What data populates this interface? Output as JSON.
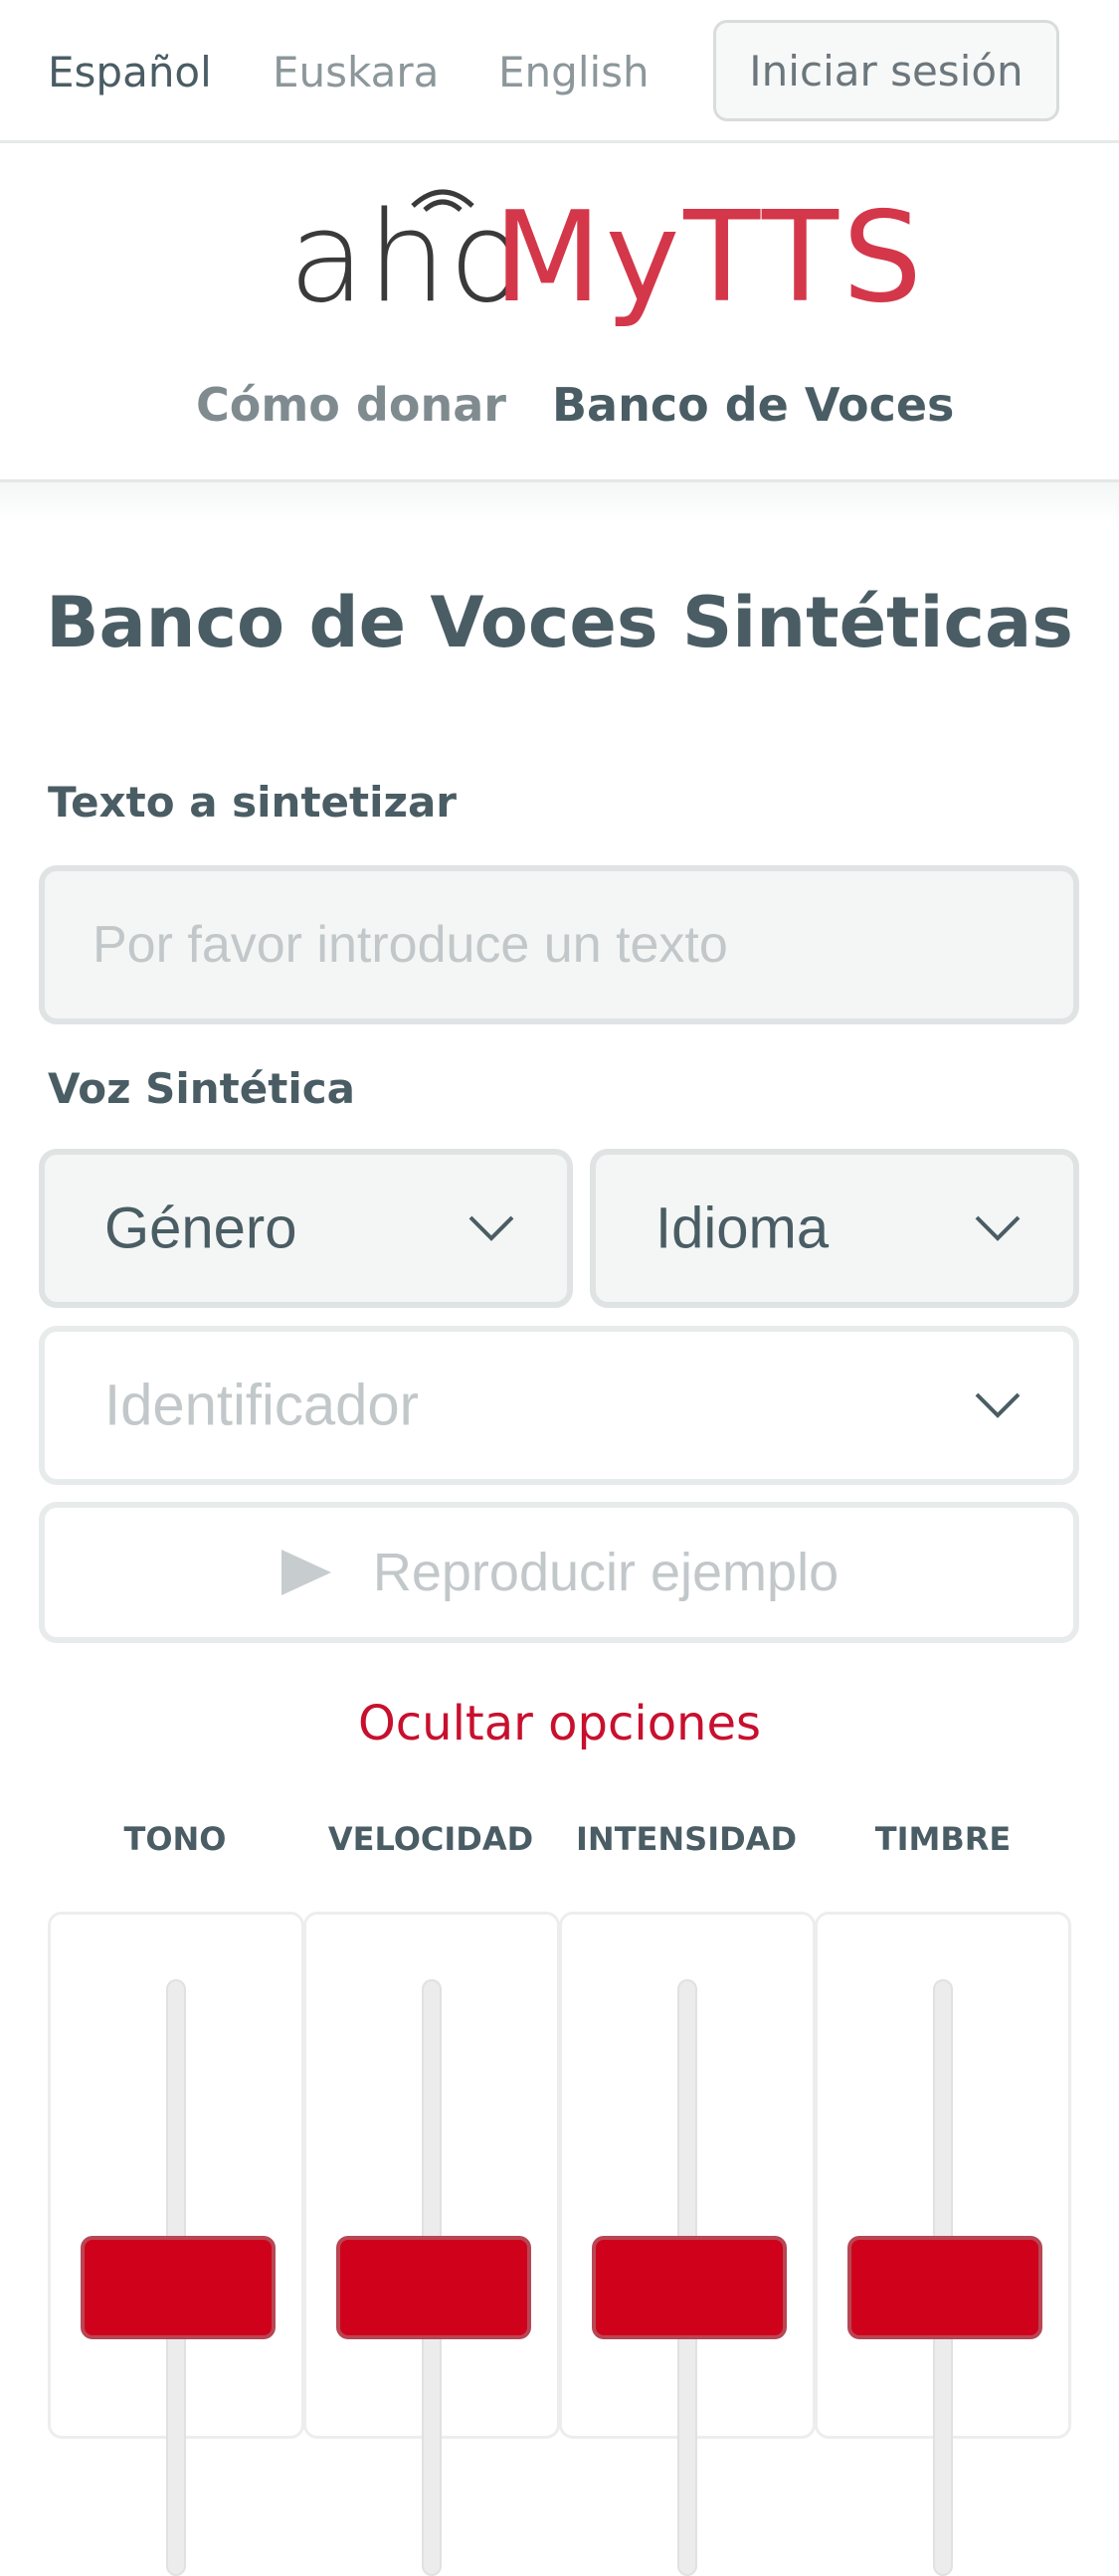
{
  "languages": [
    "Español",
    "Euskara",
    "English"
  ],
  "active_language": "Español",
  "login_label": "Iniciar sesión",
  "logo": {
    "prefix": "aho",
    "brand": "MyTTS",
    "brand_color": "#d4374a"
  },
  "nav": {
    "donate": "Cómo donar",
    "voice_bank": "Banco de Voces"
  },
  "page_title": "Banco de Voces Sintéticas",
  "text_section": {
    "label": "Texto a sintetizar",
    "placeholder": "Por favor introduce un texto",
    "value": ""
  },
  "voice_section": {
    "label": "Voz Sintética",
    "gender_select": "Género",
    "language_select": "Idioma",
    "identifier_placeholder": "Identificador",
    "play_sample": "Reproducir ejemplo"
  },
  "options_toggle": "Ocultar opciones",
  "sliders": [
    {
      "label": "TONO",
      "level": 0.5
    },
    {
      "label": "VELOCIDAD",
      "level": 0.5
    },
    {
      "label": "INTENSIDAD",
      "level": 0.5
    },
    {
      "label": "TIMBRE",
      "level": 0.5
    }
  ],
  "colors": {
    "accent": "#c8102e",
    "slider_thumb": "#d0021b",
    "text": "#4a5d64"
  },
  "icons": {
    "dropdown": "chevron-down-icon",
    "play": "play-icon"
  }
}
